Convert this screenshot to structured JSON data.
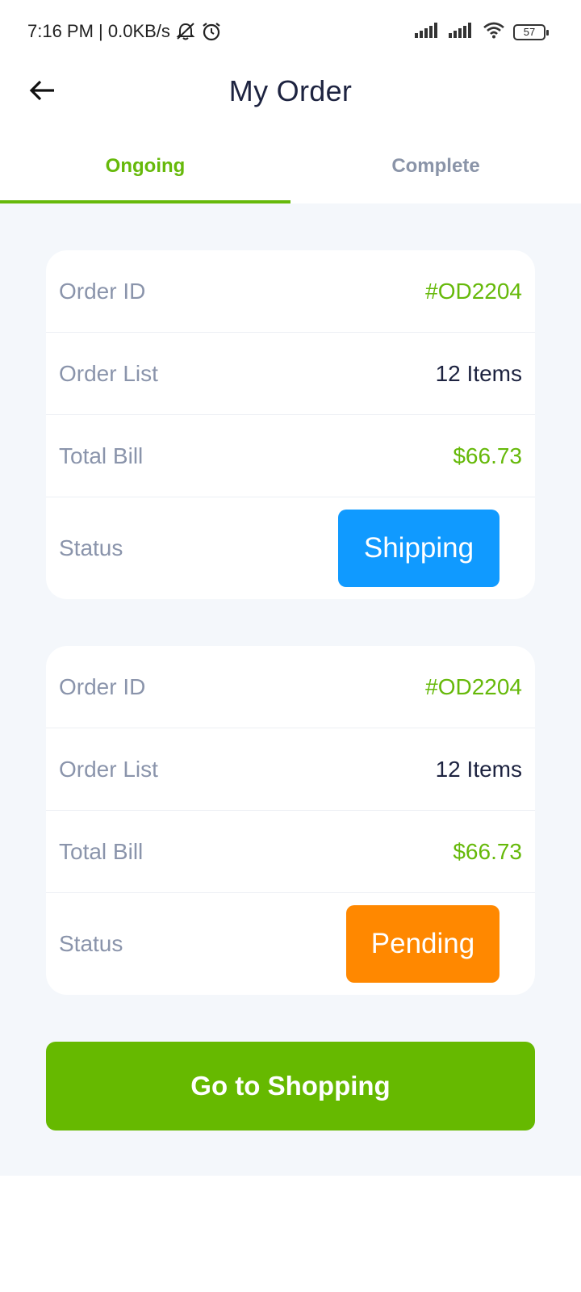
{
  "status_bar": {
    "time": "7:16 PM | 0.0KB/s",
    "battery": "57",
    "icons": [
      "mute-icon",
      "alarm-icon",
      "signal-icon",
      "signal-icon",
      "wifi-icon",
      "battery-icon"
    ]
  },
  "header": {
    "title": "My Order",
    "back_icon": "arrow-left-icon"
  },
  "tabs": [
    {
      "label": "Ongoing",
      "active": true
    },
    {
      "label": "Complete",
      "active": false
    }
  ],
  "orders": [
    {
      "order_id_label": "Order ID",
      "order_id": "#OD2204",
      "order_list_label": "Order List",
      "order_list": "12 Items",
      "total_bill_label": "Total Bill",
      "total_bill": "$66.73",
      "status_label": "Status",
      "status": "Shipping",
      "status_color": "#109AFF"
    },
    {
      "order_id_label": "Order ID",
      "order_id": "#OD2204",
      "order_list_label": "Order List",
      "order_list": "12 Items",
      "total_bill_label": "Total Bill",
      "total_bill": "$66.73",
      "status_label": "Status",
      "status": "Pending",
      "status_color": "#FF8800"
    }
  ],
  "shop_button": {
    "label": "Go to Shopping"
  },
  "colors": {
    "accent": "#66B90A",
    "background": "#F4F7FB",
    "text": "#1D2340",
    "muted": "#8A94AB"
  }
}
